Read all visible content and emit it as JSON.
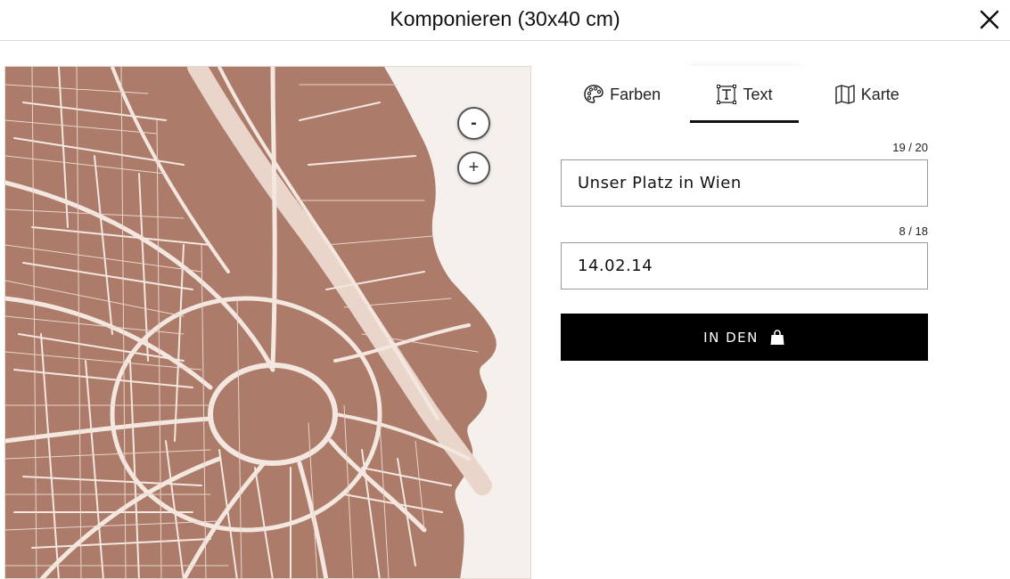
{
  "header": {
    "title": "Komponieren (30x40 cm)"
  },
  "colors": {
    "map_land": "#ad7b6a",
    "map_roads": "#f3e7e0",
    "map_background": "#f5f0ec",
    "accent": "#000000"
  },
  "map": {
    "zoom_out_label": "-",
    "zoom_in_label": "+"
  },
  "tabs": [
    {
      "label": "Farben",
      "icon": "palette-icon",
      "active": false
    },
    {
      "label": "Text",
      "icon": "text-frame-icon",
      "active": true
    },
    {
      "label": "Karte",
      "icon": "map-icon",
      "active": false
    }
  ],
  "form": {
    "line1": {
      "counter": "19 / 20",
      "value": "Unser Platz in Wien"
    },
    "line2": {
      "counter": "8 / 18",
      "value": "14.02.14"
    }
  },
  "cart_button": {
    "label": "IN DEN",
    "icon": "shopping-bag-icon"
  }
}
